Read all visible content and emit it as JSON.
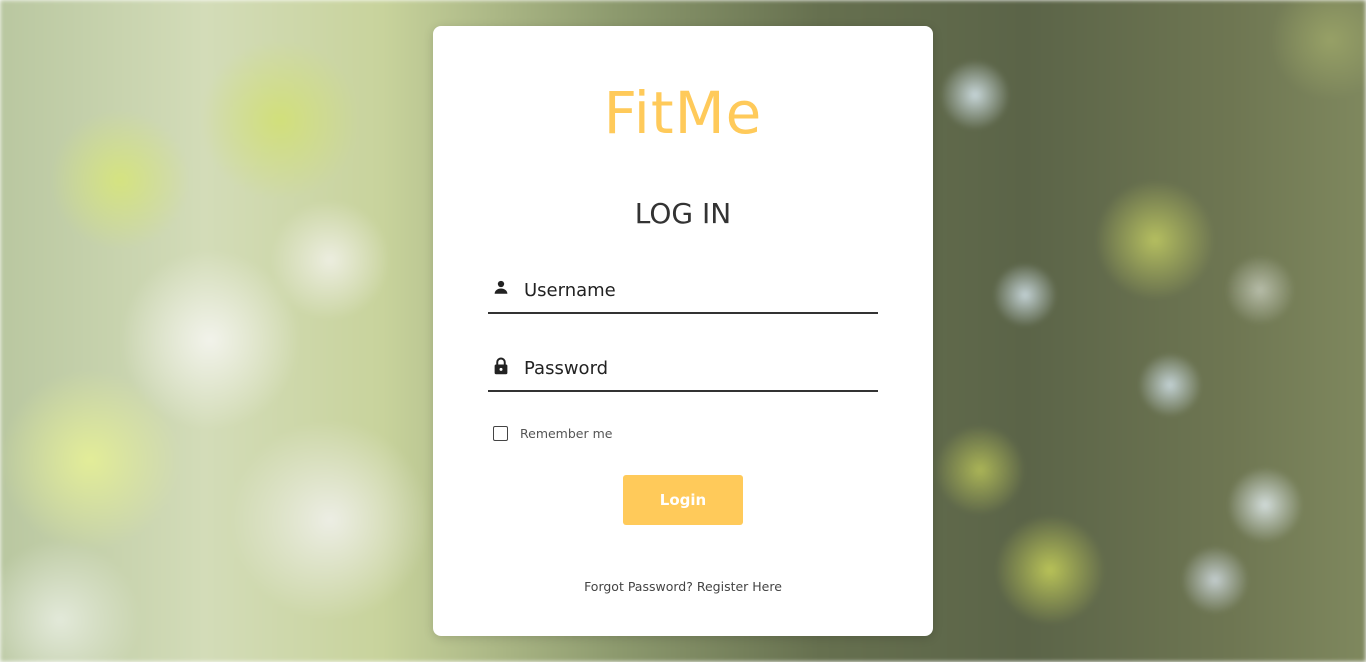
{
  "brand": {
    "name": "FitMe",
    "color": "#ffca5a"
  },
  "form": {
    "heading": "LOG IN",
    "username": {
      "placeholder": "Username",
      "value": "",
      "icon": "person-icon"
    },
    "password": {
      "placeholder": "Password",
      "value": "",
      "icon": "lock-icon"
    },
    "remember": {
      "label": "Remember me",
      "checked": false
    },
    "submit_label": "Login",
    "accent_color": "#ffca5a"
  },
  "footer": {
    "forgot_label": "Forgot Password?",
    "register_label": "Register Here"
  }
}
